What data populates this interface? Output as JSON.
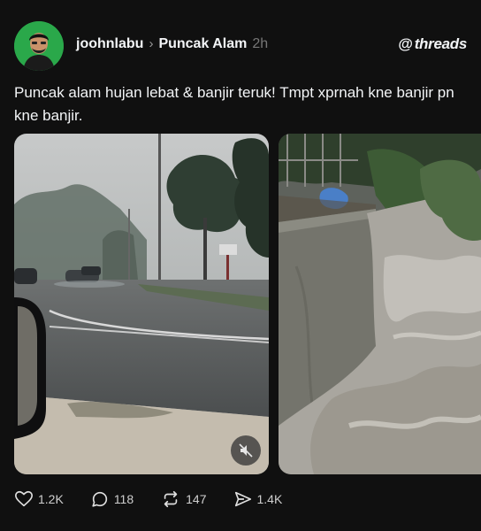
{
  "post": {
    "username": "joohnlabu",
    "community": "Puncak Alam",
    "time": "2h",
    "brand": "threads",
    "brand_mark": "@",
    "text": "Puncak alam hujan lebat &  banjir teruk! Tmpt xprnah kne banjir pn kne banjir."
  },
  "actions": {
    "likes": "1.2K",
    "replies": "118",
    "reposts": "147",
    "shares": "1.4K"
  },
  "colors": {
    "background": "#101010",
    "avatar_bg": "#2aa84a",
    "text": "#f3f5f7"
  },
  "icons": [
    "avatar",
    "chevron-right-icon",
    "threads-logo-icon",
    "mute-icon",
    "heart-icon",
    "comment-icon",
    "repost-icon",
    "share-icon"
  ]
}
